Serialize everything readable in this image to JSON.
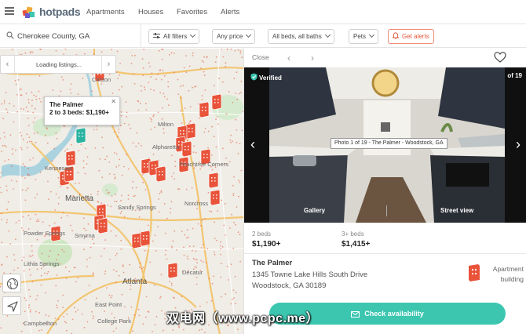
{
  "header": {
    "logo_text": "hotpads",
    "nav": [
      "Apartments",
      "Houses",
      "Favorites",
      "Alerts"
    ]
  },
  "filters": {
    "search_value": "Cherokee County, GA",
    "all_filters": "All filters",
    "price": "Any price",
    "beds_baths": "All beds, all baths",
    "pets": "Pets",
    "get_alerts": "Get alerts"
  },
  "map": {
    "loading_text": "Loading listings...",
    "popup": {
      "name": "The Palmer",
      "detail": "2 to 3 beds: $1,190+"
    },
    "cities": {
      "canton": "Canton",
      "milton": "Milton",
      "alpharetta": "Alpharetta",
      "kennesaw": "Kennesaw",
      "marietta": "Marietta",
      "sandy_springs": "Sandy Springs",
      "peachtree_corners": "Peachtree Corners",
      "norcross": "Norcross",
      "powder_springs": "Powder Springs",
      "smyrna": "Smyrna",
      "lithia_springs": "Lithia Springs",
      "atlanta": "Atlanta",
      "decatur": "Decatur",
      "east_point": "East Point",
      "campbellton": "Campbellton",
      "college_park": "College Park"
    }
  },
  "detail": {
    "close_label": "Close",
    "photo": {
      "verified": "Verified",
      "count": "of 19",
      "caption": "Photo 1 of 19 - The Palmer - Woodstock, GA",
      "gallery": "Gallery",
      "street_view": "Street view"
    },
    "units": [
      {
        "beds": "2 beds",
        "price": "$1,190+"
      },
      {
        "beds": "3+ beds",
        "price": "$1,415+"
      }
    ],
    "name": "The Palmer",
    "address_line1": "1345 Towne Lake Hills South Drive",
    "address_line2": "Woodstock, GA 30189",
    "building_type_line1": "Apartment",
    "building_type_line2": "building",
    "check_availability": "Check availability"
  },
  "watermark": "双电网（www.pcpc.me）",
  "colors": {
    "accent": "#3cc6b0",
    "alert": "#e25535",
    "pin": "#e8533a",
    "selected_pin": "#2ab3a0"
  }
}
